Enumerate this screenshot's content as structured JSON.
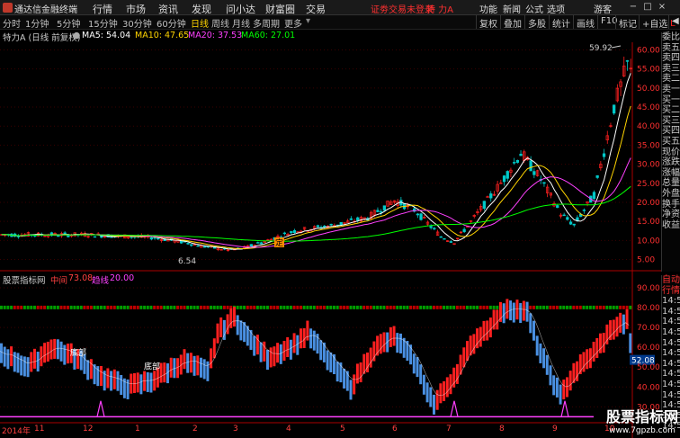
{
  "titlebar": {
    "app_title": "通达信金融终端",
    "menus": [
      "行情",
      "市场",
      "资讯",
      "发现",
      "问小达",
      "财富圈",
      "交易"
    ],
    "notice": "证劵交易未登录",
    "stock": "特 力A",
    "right_items": [
      "功能",
      "新闻",
      "公式",
      "选项"
    ],
    "guest": "游客",
    "buttons": [
      "−",
      "□",
      "×"
    ]
  },
  "toolbar": {
    "periods": [
      "分时",
      "1分钟",
      "5分钟",
      "15分钟",
      "30分钟",
      "60分钟",
      "日线",
      "周线",
      "月线",
      "多周期",
      "更多"
    ],
    "active": "日线",
    "right": [
      "复权",
      "叠加",
      "多股",
      "统计",
      "画线",
      "F10",
      "标记",
      "+自选",
      "◀"
    ]
  },
  "infobar": {
    "name": "特力A (日线 前复权)",
    "ma5": "MA5: 54.04",
    "ma10": "MA10: 47.65",
    "ma20": "MA20: 37.53",
    "ma60": "MA60: 27.01",
    "colors": {
      "ma5": "#ffffff",
      "ma10": "#ffd400",
      "ma20": "#ff40ff",
      "ma60": "#00ff00"
    }
  },
  "price_axis": [
    "60.00",
    "55.00",
    "50.00",
    "45.00",
    "40.00",
    "35.00",
    "30.00",
    "25.00",
    "20.00",
    "15.00",
    "10.00",
    "5.00"
  ],
  "price_labels": {
    "high": "59.92",
    "low": "6.54",
    "marker": "定"
  },
  "indicator": {
    "title": "股票指标网",
    "mid_label": "中间",
    "mid_value": "73.08",
    "trend_label": "趋线",
    "trend_value": "20.00",
    "last_value": "52.08",
    "axis": [
      "90.00",
      "80.00",
      "70.00",
      "60.00",
      "50.00",
      "40.00",
      "30.00"
    ],
    "annotations": [
      "底部",
      "底部"
    ]
  },
  "right_panel": {
    "top": [
      "委比",
      "卖五",
      "卖四",
      "卖三",
      "卖二",
      "卖一",
      "买一",
      "买二",
      "买三",
      "买四",
      "买五",
      "现价",
      "涨跌",
      "涨幅",
      "总量",
      "外盘",
      "换手",
      "净资",
      "收益"
    ],
    "bottom": [
      "自动",
      "行情",
      "14:5",
      "14:5",
      "14:5",
      "14:5",
      "14:5",
      "14:5",
      "14:5",
      "14:5",
      "14:5",
      "14:5",
      "14:5",
      "14:5",
      "14:5"
    ],
    "badge": "L"
  },
  "time_axis": [
    "2014年",
    "11",
    "12",
    "1",
    "2",
    "3",
    "4",
    "5",
    "6",
    "7",
    "8",
    "9",
    "10"
  ],
  "watermark": {
    "line1": "股票指标网",
    "line2": "www.7gpzb.com"
  },
  "colors": {
    "up": "#ff2020",
    "down": "#4a90e2",
    "ma5": "#ffffff",
    "ma10": "#ffd400",
    "ma20": "#ff40ff",
    "ma60": "#00ff00"
  }
}
